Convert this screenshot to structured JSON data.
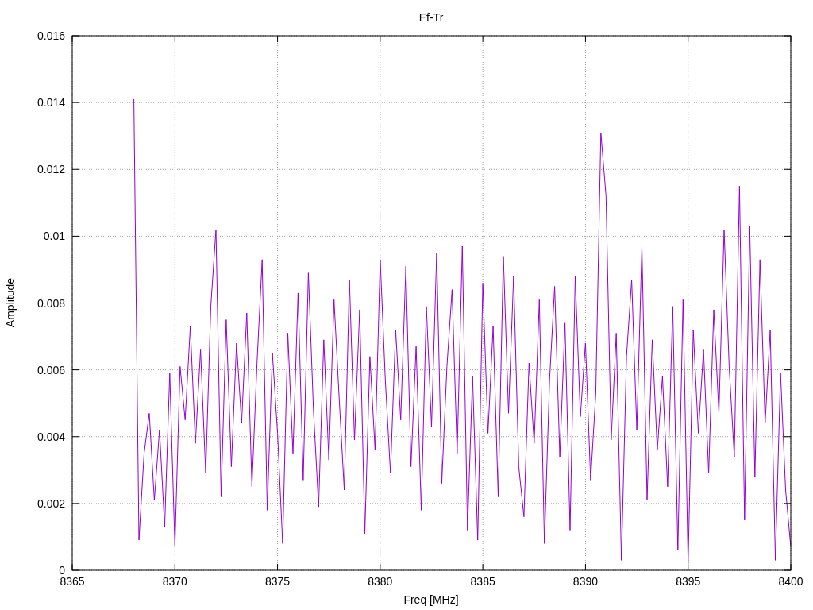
{
  "chart_data": {
    "type": "line",
    "title": "Ef-Tr",
    "xlabel": "Freq [MHz]",
    "ylabel": "Amplitude",
    "grid": true,
    "xlim": [
      8365,
      8400
    ],
    "ylim": [
      0,
      0.016
    ],
    "xticks": [
      8365,
      8370,
      8375,
      8380,
      8385,
      8390,
      8395,
      8400
    ],
    "yticks": [
      {
        "value": 0,
        "label": "0"
      },
      {
        "value": 0.002,
        "label": "0.002"
      },
      {
        "value": 0.004,
        "label": "0.004"
      },
      {
        "value": 0.006,
        "label": "0.006"
      },
      {
        "value": 0.008,
        "label": "0.008"
      },
      {
        "value": 0.01,
        "label": "0.01"
      },
      {
        "value": 0.012,
        "label": "0.012"
      },
      {
        "value": 0.014,
        "label": "0.014"
      },
      {
        "value": 0.016,
        "label": "0.016"
      }
    ],
    "x": [
      8368,
      8368.25,
      8368.5,
      8368.75,
      8369,
      8369.25,
      8369.5,
      8369.75,
      8370,
      8370.25,
      8370.5,
      8370.75,
      8371,
      8371.25,
      8371.5,
      8371.75,
      8372,
      8372.25,
      8372.5,
      8372.75,
      8373,
      8373.25,
      8373.5,
      8373.75,
      8374,
      8374.25,
      8374.5,
      8374.75,
      8375,
      8375.25,
      8375.5,
      8375.75,
      8376,
      8376.25,
      8376.5,
      8376.75,
      8377,
      8377.25,
      8377.5,
      8377.75,
      8378,
      8378.25,
      8378.5,
      8378.75,
      8379,
      8379.25,
      8379.5,
      8379.75,
      8380,
      8380.25,
      8380.5,
      8380.75,
      8381,
      8381.25,
      8381.5,
      8381.75,
      8382,
      8382.25,
      8382.5,
      8382.75,
      8383,
      8383.25,
      8383.5,
      8383.75,
      8384,
      8384.25,
      8384.5,
      8384.75,
      8385,
      8385.25,
      8385.5,
      8385.75,
      8386,
      8386.25,
      8386.5,
      8386.75,
      8387,
      8387.25,
      8387.5,
      8387.75,
      8388,
      8388.25,
      8388.5,
      8388.75,
      8389,
      8389.25,
      8389.5,
      8389.75,
      8390,
      8390.25,
      8390.5,
      8390.75,
      8391,
      8391.25,
      8391.5,
      8391.75,
      8392,
      8392.25,
      8392.5,
      8392.75,
      8393,
      8393.25,
      8393.5,
      8393.75,
      8394,
      8394.25,
      8394.5,
      8394.75,
      8395,
      8395.25,
      8395.5,
      8395.75,
      8396,
      8396.25,
      8396.5,
      8396.75,
      8397,
      8397.25,
      8397.5,
      8397.75,
      8398,
      8398.25,
      8398.5,
      8398.75,
      8399,
      8399.25,
      8399.5,
      8399.75,
      8400
    ],
    "series": [
      {
        "color": "#9400d3",
        "values": [
          0.0141,
          0.0009,
          0.0035,
          0.0047,
          0.0021,
          0.0042,
          0.0013,
          0.0059,
          0.0007,
          0.0061,
          0.0045,
          0.0073,
          0.0038,
          0.0066,
          0.0029,
          0.0079,
          0.0102,
          0.0022,
          0.0075,
          0.0031,
          0.0068,
          0.0044,
          0.0077,
          0.0025,
          0.0062,
          0.0093,
          0.0018,
          0.0065,
          0.0041,
          0.0008,
          0.0071,
          0.0035,
          0.0083,
          0.0027,
          0.0089,
          0.0048,
          0.0019,
          0.0069,
          0.0033,
          0.0081,
          0.0052,
          0.0024,
          0.0087,
          0.0039,
          0.0078,
          0.0011,
          0.0064,
          0.0036,
          0.0093,
          0.0057,
          0.0029,
          0.0072,
          0.0045,
          0.0091,
          0.0031,
          0.0067,
          0.0018,
          0.0079,
          0.0043,
          0.0095,
          0.0026,
          0.0061,
          0.0084,
          0.0035,
          0.0097,
          0.0012,
          0.0058,
          0.0009,
          0.0086,
          0.0041,
          0.0073,
          0.0022,
          0.0094,
          0.0047,
          0.0088,
          0.0031,
          0.0016,
          0.0062,
          0.0038,
          0.0081,
          0.0008,
          0.0057,
          0.0085,
          0.0034,
          0.0074,
          0.0012,
          0.0088,
          0.0046,
          0.0068,
          0.0027,
          0.0053,
          0.0131,
          0.0112,
          0.0039,
          0.0071,
          0.0003,
          0.0064,
          0.0087,
          0.0042,
          0.0097,
          0.0021,
          0.0069,
          0.0036,
          0.0058,
          0.0025,
          0.0079,
          0.0006,
          0.0081,
          0.0002,
          0.0072,
          0.0041,
          0.0066,
          0.0029,
          0.0078,
          0.0047,
          0.0102,
          0.0061,
          0.0034,
          0.0115,
          0.0015,
          0.0103,
          0.0028,
          0.0093,
          0.0044,
          0.0072,
          0.0003,
          0.0059,
          0.0024,
          0.0007
        ]
      }
    ]
  }
}
